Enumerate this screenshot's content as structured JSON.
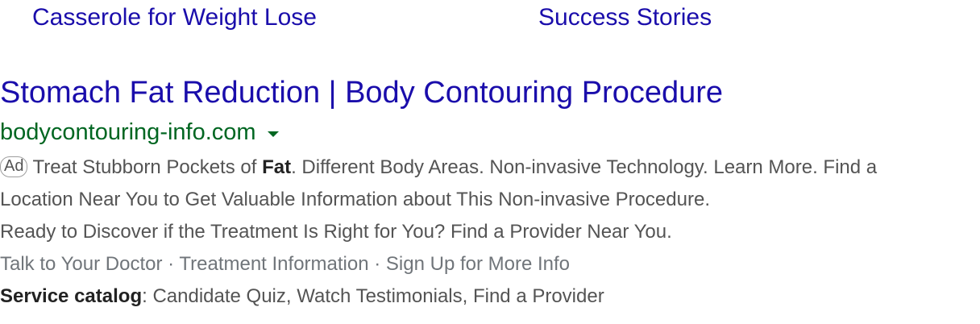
{
  "sitelinks": [
    {
      "label": "Casserole for Weight Lose"
    },
    {
      "label": "Success Stories"
    }
  ],
  "ad": {
    "title": "Stomach Fat Reduction | Body Contouring Procedure",
    "display_url": "bodycontouring-info.com",
    "badge": "Ad",
    "desc_line1_a": "Treat Stubborn Pockets of ",
    "desc_line1_bold": "Fat",
    "desc_line1_b": ". Different Body Areas. Non-invasive Technology. Learn More. Find a",
    "desc_line2": "Location Near You to Get Valuable Information about This Non-invasive Procedure.",
    "desc_line3": "Ready to Discover if the Treatment Is Right for You? Find a Provider Near You.",
    "callouts": [
      "Talk to Your Doctor",
      "Treatment Information",
      "Sign Up for More Info"
    ],
    "callout_separator": " · ",
    "structured_snippet_header": "Service catalog",
    "structured_snippet_values": ": Candidate Quiz, Watch Testimonials, Find a Provider"
  },
  "colors": {
    "link": "#1a0dab",
    "url": "#006621",
    "text": "#545454"
  }
}
